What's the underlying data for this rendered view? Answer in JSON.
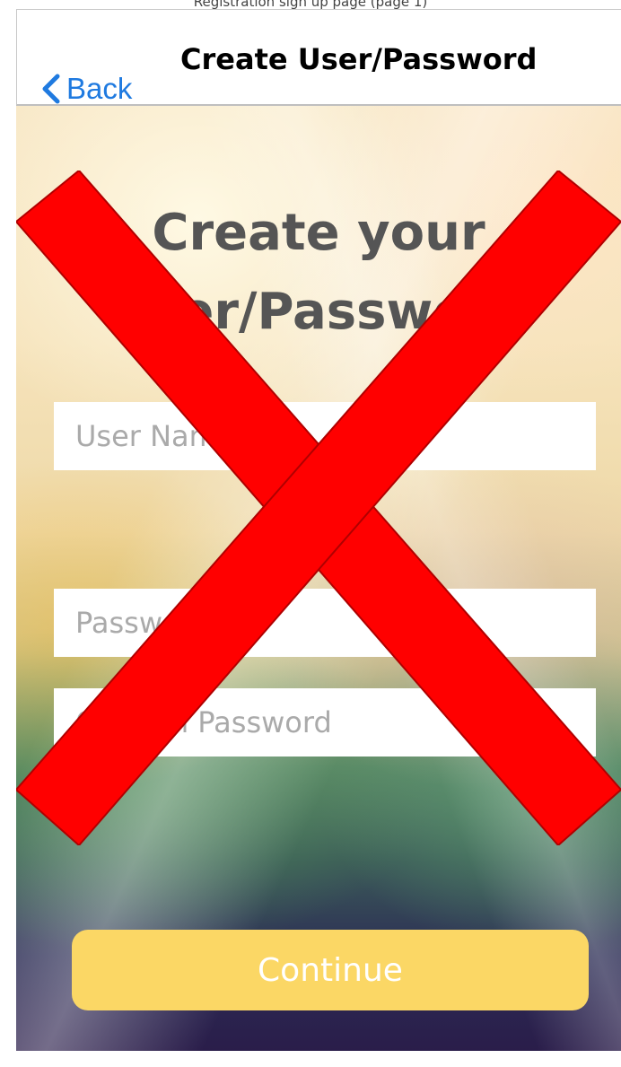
{
  "caption": "Registration sign up page (page 1)",
  "nav": {
    "title": "Create User/Password",
    "back_label": "Back"
  },
  "heading": {
    "line1": "Create your",
    "line2": "User/Password"
  },
  "form": {
    "username_placeholder": "User Name",
    "password_placeholder": "Password",
    "confirm_placeholder": "Confirm Password"
  },
  "continue_label": "Continue",
  "colors": {
    "accent_blue": "#1f7ae0",
    "continue_bg": "#fbd765",
    "cross_red": "#ff0000"
  }
}
